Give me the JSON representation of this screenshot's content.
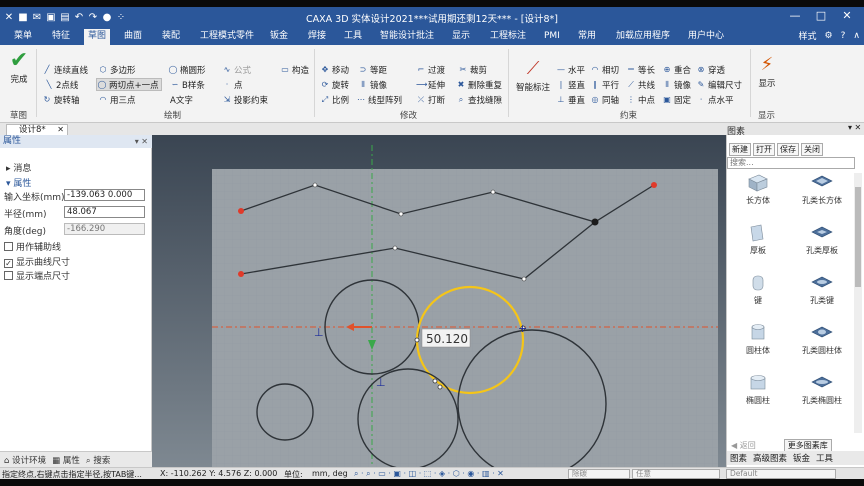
{
  "window": {
    "title": "CAXA 3D 实体设计2021***试用期还剩12天*** - [设计8*]",
    "controls": [
      "—",
      "□",
      "✕"
    ]
  },
  "quick_access_icons": [
    "menu-icon",
    "new-icon",
    "mail-icon",
    "save-icon",
    "print-icon",
    "undo-icon",
    "redo-icon",
    "sphere-icon",
    "pointer-icon"
  ],
  "ribbon_tabs": [
    {
      "label": "菜单"
    },
    {
      "label": "特征"
    },
    {
      "label": "草图",
      "active": true
    },
    {
      "label": "曲面"
    },
    {
      "label": "装配"
    },
    {
      "label": "工程模式零件"
    },
    {
      "label": "钣金"
    },
    {
      "label": "焊接"
    },
    {
      "label": "工具"
    },
    {
      "label": "智能设计批注"
    },
    {
      "label": "显示"
    },
    {
      "label": "工程标注"
    },
    {
      "label": "PMI"
    },
    {
      "label": "常用"
    },
    {
      "label": "加载应用程序"
    },
    {
      "label": "用户中心"
    }
  ],
  "ribbon_right": {
    "style_label": "样式",
    "help": "?"
  },
  "ribbon": {
    "finish": {
      "label": "完成",
      "group": "草图"
    },
    "draw_group": "绘制",
    "draw_items": [
      "连续直线",
      "多边形",
      "椭圆形",
      "公式",
      "构造",
      "2点线",
      "两切点+一点",
      "B样条",
      "点",
      "旋转轴",
      "用三点",
      "A文字",
      "投影约束"
    ],
    "modify_group": "修改",
    "modify_items": [
      "移动",
      "等距",
      "过渡",
      "裁剪",
      "旋转",
      "镜像",
      "延伸",
      "删除重复",
      "比例",
      "线型阵列",
      "打断",
      "查找缝隙"
    ],
    "smart_label": "智能标注",
    "constraint_group": "约束",
    "constraint_items": [
      "水平",
      "相切",
      "等长",
      "重合",
      "穿透",
      "竖直",
      "平行",
      "共线",
      "镜像",
      "编辑尺寸",
      "垂直",
      "同轴",
      "中点",
      "固定",
      "点水平"
    ],
    "display": {
      "label": "显示",
      "group": "显示"
    }
  },
  "doc_tab": {
    "label": "设计8*",
    "close": "✕"
  },
  "left_panel": {
    "header": "属性",
    "header_controls": "▾ ✕",
    "message_section": "消息",
    "props_section": "属性",
    "fields": [
      {
        "label": "输入坐标(mm)",
        "value": "-139.063 0.000",
        "readonly": false
      },
      {
        "label": "半径(mm)",
        "value": "48.067",
        "readonly": false
      },
      {
        "label": "角度(deg)",
        "value": "-166.290",
        "readonly": true
      }
    ],
    "checkboxes": [
      {
        "label": "用作辅助线",
        "checked": false
      },
      {
        "label": "显示曲线尺寸",
        "checked": true
      },
      {
        "label": "显示端点尺寸",
        "checked": false
      }
    ]
  },
  "left_tabs": [
    "设计环境",
    "属性",
    "搜索"
  ],
  "canvas": {
    "dimension_label": "50.120"
  },
  "library": {
    "title": "图素",
    "pin": "▾ ✕",
    "toolbar": [
      "新建",
      "打开",
      "保存",
      "关闭"
    ],
    "search_placeholder": "搜索...",
    "items": [
      "长方体",
      "孔类长方体",
      "厚板",
      "孔类厚板",
      "键",
      "孔类键",
      "圆柱体",
      "孔类圆柱体",
      "椭圆柱",
      "孔类椭圆柱"
    ],
    "back": "返回",
    "more": "更多图素库",
    "tabs": [
      "图素",
      "高级图素",
      "钣金",
      "工具"
    ]
  },
  "status": {
    "hint": "指定终点,右键点击指定半径,按TAB键...",
    "coords": "X: -110.262 Y: 4.576 Z: 0.000",
    "unit_label": "单位:",
    "unit_value": "mm, deg",
    "box1": "除碳",
    "box2": "任意",
    "box3": "Default"
  }
}
